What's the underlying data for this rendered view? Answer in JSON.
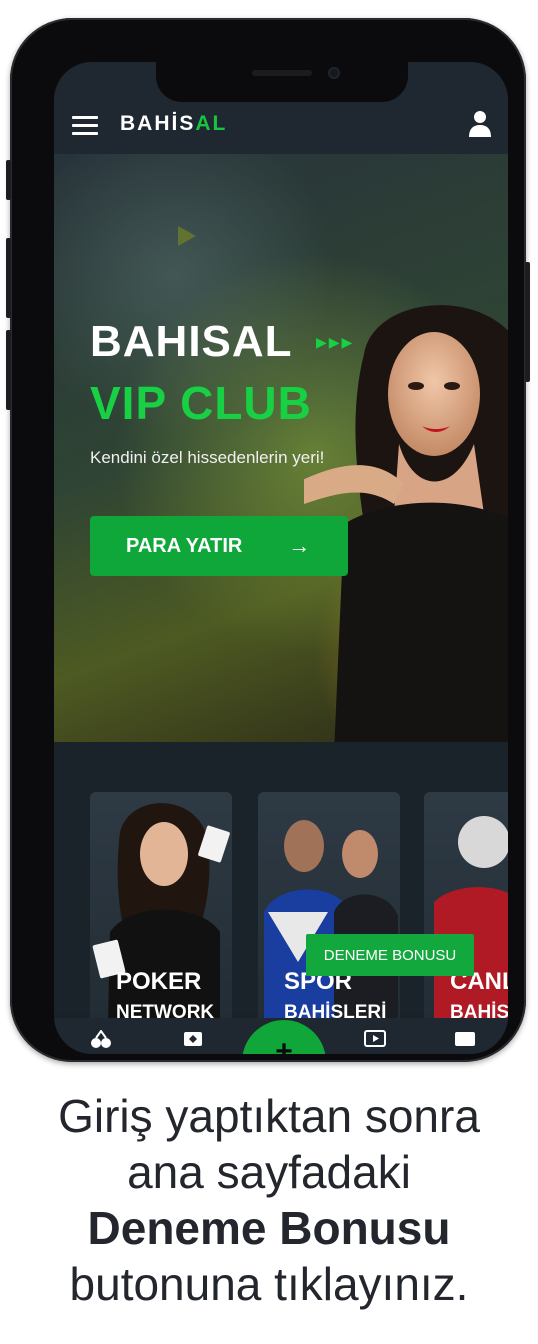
{
  "app": {
    "logo_main": "BAHİS",
    "logo_accent": "AL"
  },
  "hero": {
    "title": "BAHISAL",
    "subtitle": "VIP CLUB",
    "tagline": "Kendini özel hissedenlerin yeri!",
    "arrows": "▶▶▶",
    "deposit_label": "PARA YATIR",
    "deposit_arrow": "→"
  },
  "cards": [
    {
      "title": "POKER",
      "sub": "NETWORK"
    },
    {
      "title": "SPOR",
      "sub": "BAHİSLERİ"
    },
    {
      "title": "CANLI",
      "sub": "BAHİS"
    }
  ],
  "bonus_button": {
    "label": "DENEME BONUSU"
  },
  "bottom_nav": {
    "fab_label": "+",
    "icons": [
      "slot-cherries-icon",
      "cards-icon",
      "plus-icon",
      "tv-play-icon",
      "chat-icon"
    ]
  },
  "caption": {
    "line1": "Giriş yaptıktan sonra",
    "line2": "ana sayfadaki",
    "line3": "Deneme Bonusu",
    "line4": "butonuna tıklayınız."
  },
  "colors": {
    "brand_green": "#18c43f",
    "button_green": "#0fa63a",
    "header_bg": "#1f2731"
  }
}
